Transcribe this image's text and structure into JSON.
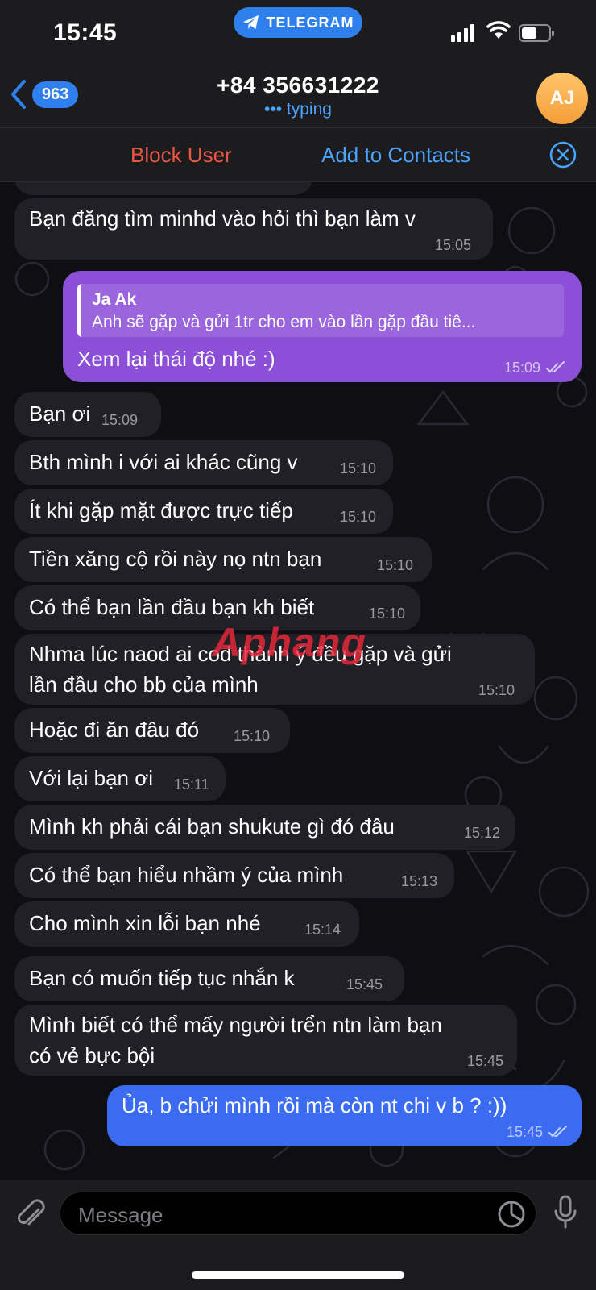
{
  "status_bar": {
    "time": "15:45",
    "app_pill": "TELEGRAM",
    "battery_level": 0.55
  },
  "header": {
    "unread_count": "963",
    "title": "+84 356631222",
    "status": "••• typing",
    "avatar_initials": "AJ"
  },
  "action_bar": {
    "block": "Block User",
    "add_contact": "Add to Contacts"
  },
  "messages": [
    {
      "dir": "in",
      "text": "Bạn đăng tìm minhd vào hỏi thì bạn làm v",
      "time": "15:05"
    },
    {
      "dir": "out",
      "reply_name": "Ja Ak",
      "reply_text": "Anh sẽ gặp và gửi 1tr cho em vào lần gặp đầu tiê...",
      "text": "Xem lại thái độ nhé :)",
      "time": "15:09"
    },
    {
      "dir": "in",
      "text": "Bạn ơi",
      "time": "15:09"
    },
    {
      "dir": "in",
      "text": "Bth mình i với ai khác cũng v",
      "time": "15:10"
    },
    {
      "dir": "in",
      "text": "Ít khi gặp mặt được trực tiếp",
      "time": "15:10"
    },
    {
      "dir": "in",
      "text": "Tiền xăng cộ rồi này nọ ntn bạn",
      "time": "15:10"
    },
    {
      "dir": "in",
      "text": "Có thể bạn lần đầu bạn kh biết",
      "time": "15:10"
    },
    {
      "dir": "in",
      "line1": "Nhma lúc naod ai cod thành ý đều gặp và gửi",
      "line2": "lần đầu cho bb của mình",
      "time": "15:10"
    },
    {
      "dir": "in",
      "text": "Hoặc đi ăn đâu đó",
      "time": "15:10"
    },
    {
      "dir": "in",
      "text": "Với lại bạn ơi",
      "time": "15:11"
    },
    {
      "dir": "in",
      "text": "Mình kh phải cái bạn shukute gì đó đâu",
      "time": "15:12"
    },
    {
      "dir": "in",
      "text": "Có thể bạn hiểu nhầm ý của mình",
      "time": "15:13"
    },
    {
      "dir": "in",
      "text": "Cho mình xin lỗi bạn nhé",
      "time": "15:14"
    },
    {
      "dir": "in",
      "text": "Bạn có muốn tiếp tục nhắn k",
      "time": "15:45"
    },
    {
      "dir": "in",
      "line1": "Mình biết có thể mấy người trển ntn làm bạn",
      "line2": "có vẻ bực bội",
      "time": "15:45"
    },
    {
      "dir": "out",
      "text": "Ủa, b chửi mình rồi mà còn nt chi v b ? :))",
      "time": "15:45"
    }
  ],
  "watermark": "Aphang",
  "input": {
    "placeholder": "Message"
  },
  "colors": {
    "accent": "#2f80ed",
    "outgoing_purple": "#8b4fd8",
    "outgoing_blue": "#3b6bf1",
    "danger": "#eb5545",
    "incoming": "#222128"
  },
  "icons": [
    "telegram-icon",
    "back-chevron-icon",
    "close-circle-icon",
    "read-checks-icon",
    "attach-icon",
    "sticker-icon",
    "mic-icon"
  ]
}
